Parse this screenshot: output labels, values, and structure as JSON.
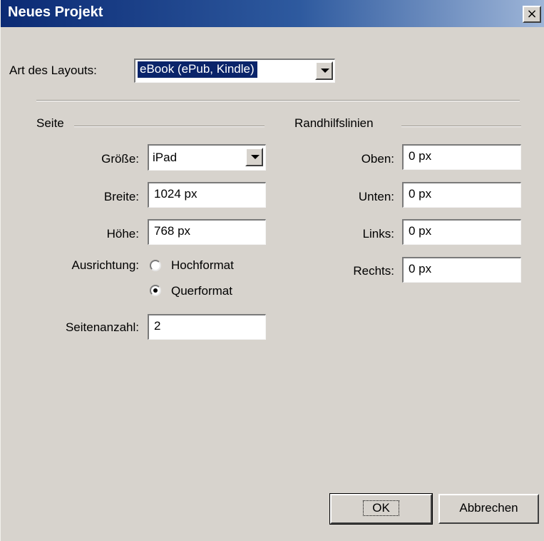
{
  "window": {
    "title": "Neues Projekt",
    "close_symbol": "×"
  },
  "layout_type": {
    "label": "Art des Layouts:",
    "value": "eBook (ePub, Kindle)"
  },
  "page_section": {
    "title": "Seite",
    "size_label": "Größe:",
    "size_value": "iPad",
    "width_label": "Breite:",
    "width_value": "1024 px",
    "height_label": "Höhe:",
    "height_value": "768 px",
    "orientation_label": "Ausrichtung:",
    "orientation_options": [
      {
        "label": "Hochformat",
        "selected": false
      },
      {
        "label": "Querformat",
        "selected": true
      }
    ],
    "page_count_label": "Seitenanzahl:",
    "page_count_value": "2"
  },
  "margins_section": {
    "title": "Randhilfslinien",
    "top_label": "Oben:",
    "top_value": "0 px",
    "bottom_label": "Unten:",
    "bottom_value": "0 px",
    "left_label": "Links:",
    "left_value": "0 px",
    "right_label": "Rechts:",
    "right_value": "0 px"
  },
  "buttons": {
    "ok": "OK",
    "cancel": "Abbrechen"
  },
  "icons": {
    "close": "close-icon",
    "dropdown": "chevron-down-icon"
  },
  "colors": {
    "titlebar_start": "#0b2a74",
    "titlebar_end": "#9fb6d8",
    "dialog_bg": "#d7d3cd",
    "selection_bg": "#0a246a"
  }
}
